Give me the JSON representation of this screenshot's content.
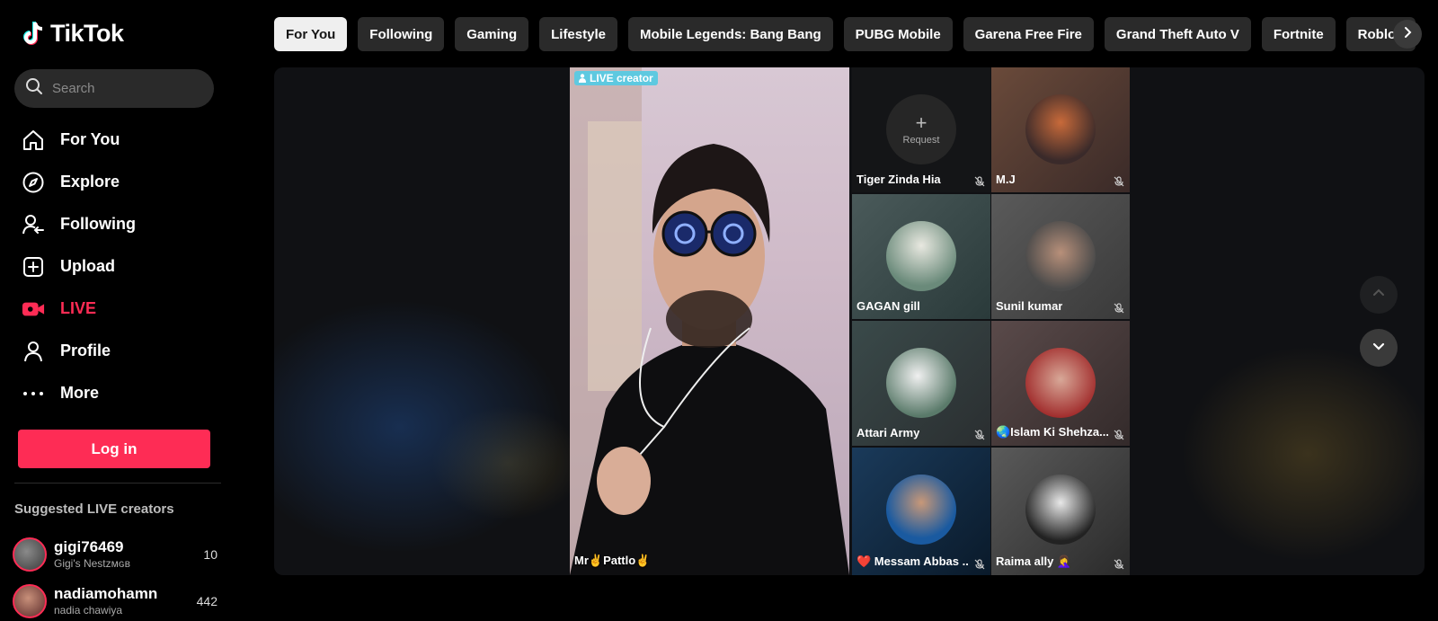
{
  "brand": {
    "name": "TikTok"
  },
  "search": {
    "placeholder": "Search"
  },
  "nav": [
    {
      "label": "For You",
      "icon": "home-icon"
    },
    {
      "label": "Explore",
      "icon": "compass-icon"
    },
    {
      "label": "Following",
      "icon": "following-icon"
    },
    {
      "label": "Upload",
      "icon": "upload-icon"
    },
    {
      "label": "LIVE",
      "icon": "live-icon"
    },
    {
      "label": "Profile",
      "icon": "profile-icon"
    },
    {
      "label": "More",
      "icon": "more-icon"
    }
  ],
  "login_label": "Log in",
  "suggested": {
    "title": "Suggested LIVE creators",
    "creators": [
      {
        "name": "gigi76469",
        "subtitle": "Gigi's Nestᴢᴍɢʙ",
        "count": "10"
      },
      {
        "name": "nadiamohamn",
        "subtitle": "nadia chawiya",
        "count": "442"
      }
    ]
  },
  "tabs": [
    "For You",
    "Following",
    "Gaming",
    "Lifestyle",
    "Mobile Legends: Bang Bang",
    "PUBG Mobile",
    "Garena Free Fire",
    "Grand Theft Auto V",
    "Fortnite",
    "Roblox"
  ],
  "stream": {
    "badge": "LIVE creator",
    "host_name": "Mr✌️Pattlo✌️",
    "request_label": "Request",
    "guests": [
      {
        "name": "Tiger Zinda Hia"
      },
      {
        "name": "M.J"
      },
      {
        "name": "GAGAN gill"
      },
      {
        "name": "Sunil kumar"
      },
      {
        "name": "Attari Army"
      },
      {
        "name": "🌏Islam Ki Shehza..."
      },
      {
        "name": "❤️ Messam Abbas ..."
      },
      {
        "name": "Raima ally 🤦‍♀️"
      }
    ]
  },
  "colors": {
    "accent": "#fe2c55",
    "live_badge": "#5ec9e0"
  }
}
